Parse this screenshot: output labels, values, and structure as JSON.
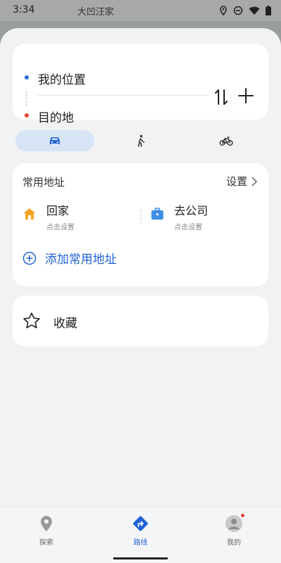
{
  "status_bar": {
    "time": "3:34",
    "place": "大凹汪家",
    "icons": [
      "location-icon",
      "do-not-disturb-icon",
      "wifi-icon",
      "battery-icon"
    ]
  },
  "route": {
    "from_label": "我的位置",
    "to_label": "目的地",
    "from_dot_color": "#2a6cdf",
    "to_dot_color": "#e6472d"
  },
  "modes": {
    "active": "car",
    "active_bg": "#d7e4f6",
    "items": [
      "car-icon",
      "walk-icon",
      "bike-icon"
    ]
  },
  "frequent": {
    "title": "常用地址",
    "settings_label": "设置",
    "home": {
      "title": "回家",
      "subtitle": "点击设置",
      "icon_color": "#f4a528"
    },
    "work": {
      "title": "去公司",
      "subtitle": "点击设置",
      "icon_color": "#3e8fe8"
    },
    "add_label": "添加常用地址",
    "accent": "#2062d6"
  },
  "collection": {
    "label": "收藏"
  },
  "nav": {
    "items": [
      {
        "label": "探索",
        "icon": "explore-pin-icon"
      },
      {
        "label": "路线",
        "icon": "route-icon",
        "active": true
      },
      {
        "label": "我的",
        "icon": "avatar-icon",
        "badge": true
      }
    ]
  }
}
